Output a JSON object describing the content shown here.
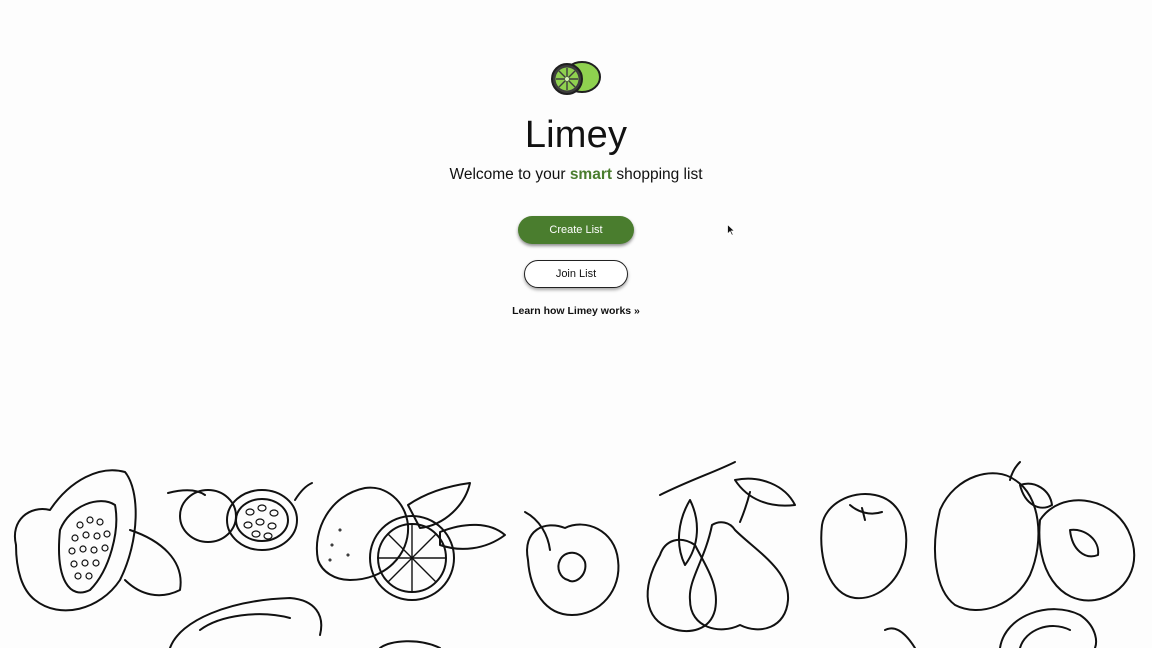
{
  "app": {
    "name": "Limey",
    "logo_icon": "lime-logo-icon"
  },
  "hero": {
    "title": "Limey",
    "tagline_before": "Welcome to your ",
    "tagline_accent": "smart",
    "tagline_after": " shopping list"
  },
  "actions": {
    "create_label": "Create List",
    "join_label": "Join List",
    "learn_label": "Learn how Limey works »"
  },
  "colors": {
    "brand_green": "#4a7d2e",
    "lime_light": "#8fd14f",
    "background": "#fdfdfd"
  },
  "decor": {
    "illustration": "fruit-line-art-illustration"
  }
}
